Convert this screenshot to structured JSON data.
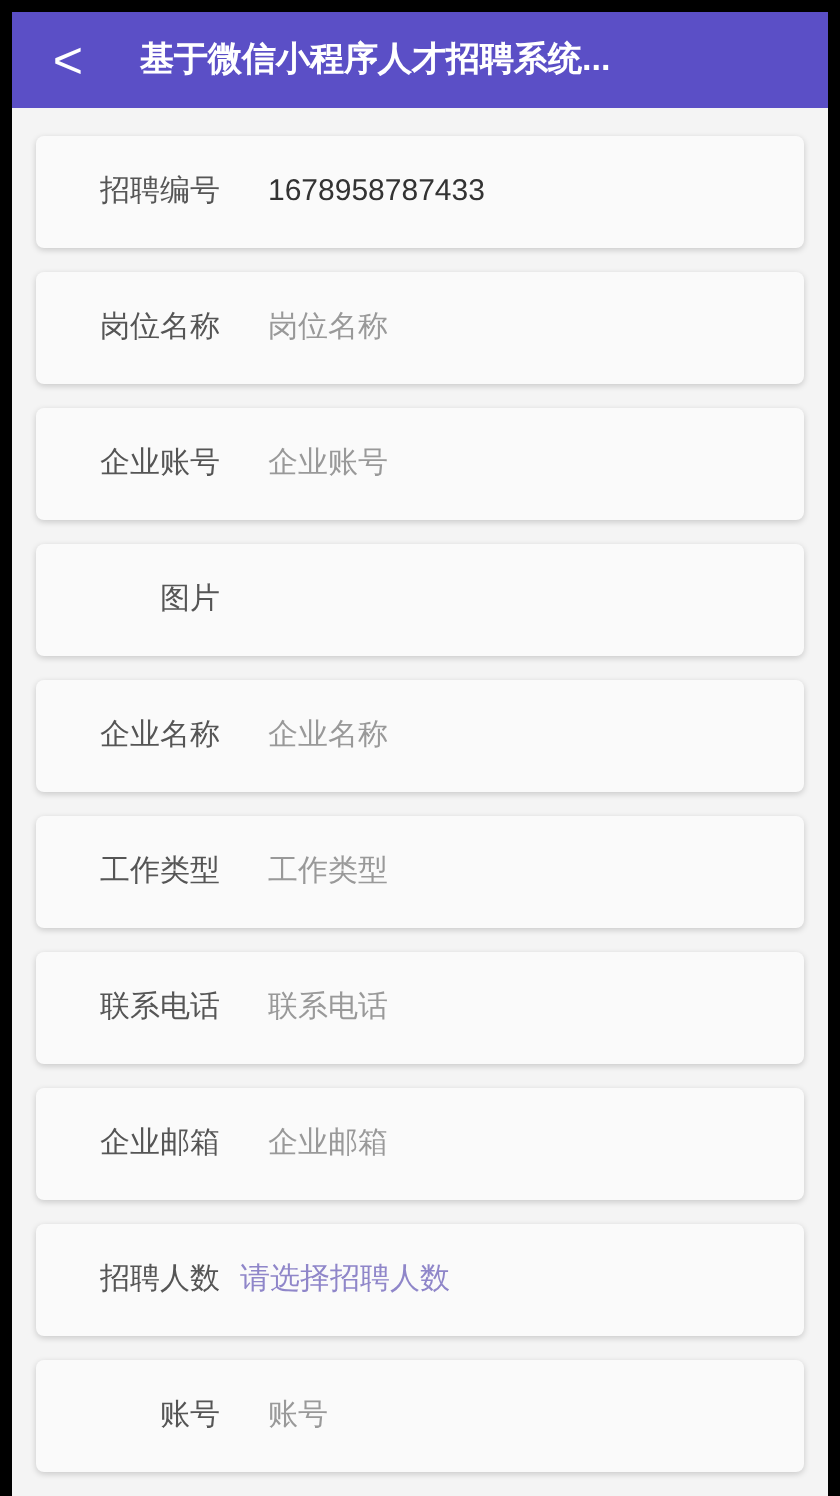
{
  "header": {
    "back": "<",
    "title": "基于微信小程序人才招聘系统..."
  },
  "fields": [
    {
      "kind": "value",
      "label": "招聘编号",
      "value": "1678958787433"
    },
    {
      "kind": "input",
      "label": "岗位名称",
      "placeholder": "岗位名称"
    },
    {
      "kind": "input",
      "label": "企业账号",
      "placeholder": "企业账号"
    },
    {
      "kind": "image",
      "label": "图片"
    },
    {
      "kind": "input",
      "label": "企业名称",
      "placeholder": "企业名称"
    },
    {
      "kind": "input",
      "label": "工作类型",
      "placeholder": "工作类型"
    },
    {
      "kind": "input",
      "label": "联系电话",
      "placeholder": "联系电话"
    },
    {
      "kind": "input",
      "label": "企业邮箱",
      "placeholder": "企业邮箱"
    },
    {
      "kind": "select",
      "label": "招聘人数",
      "placeholder": "请选择招聘人数"
    },
    {
      "kind": "input",
      "label": "账号",
      "placeholder": "账号"
    }
  ]
}
